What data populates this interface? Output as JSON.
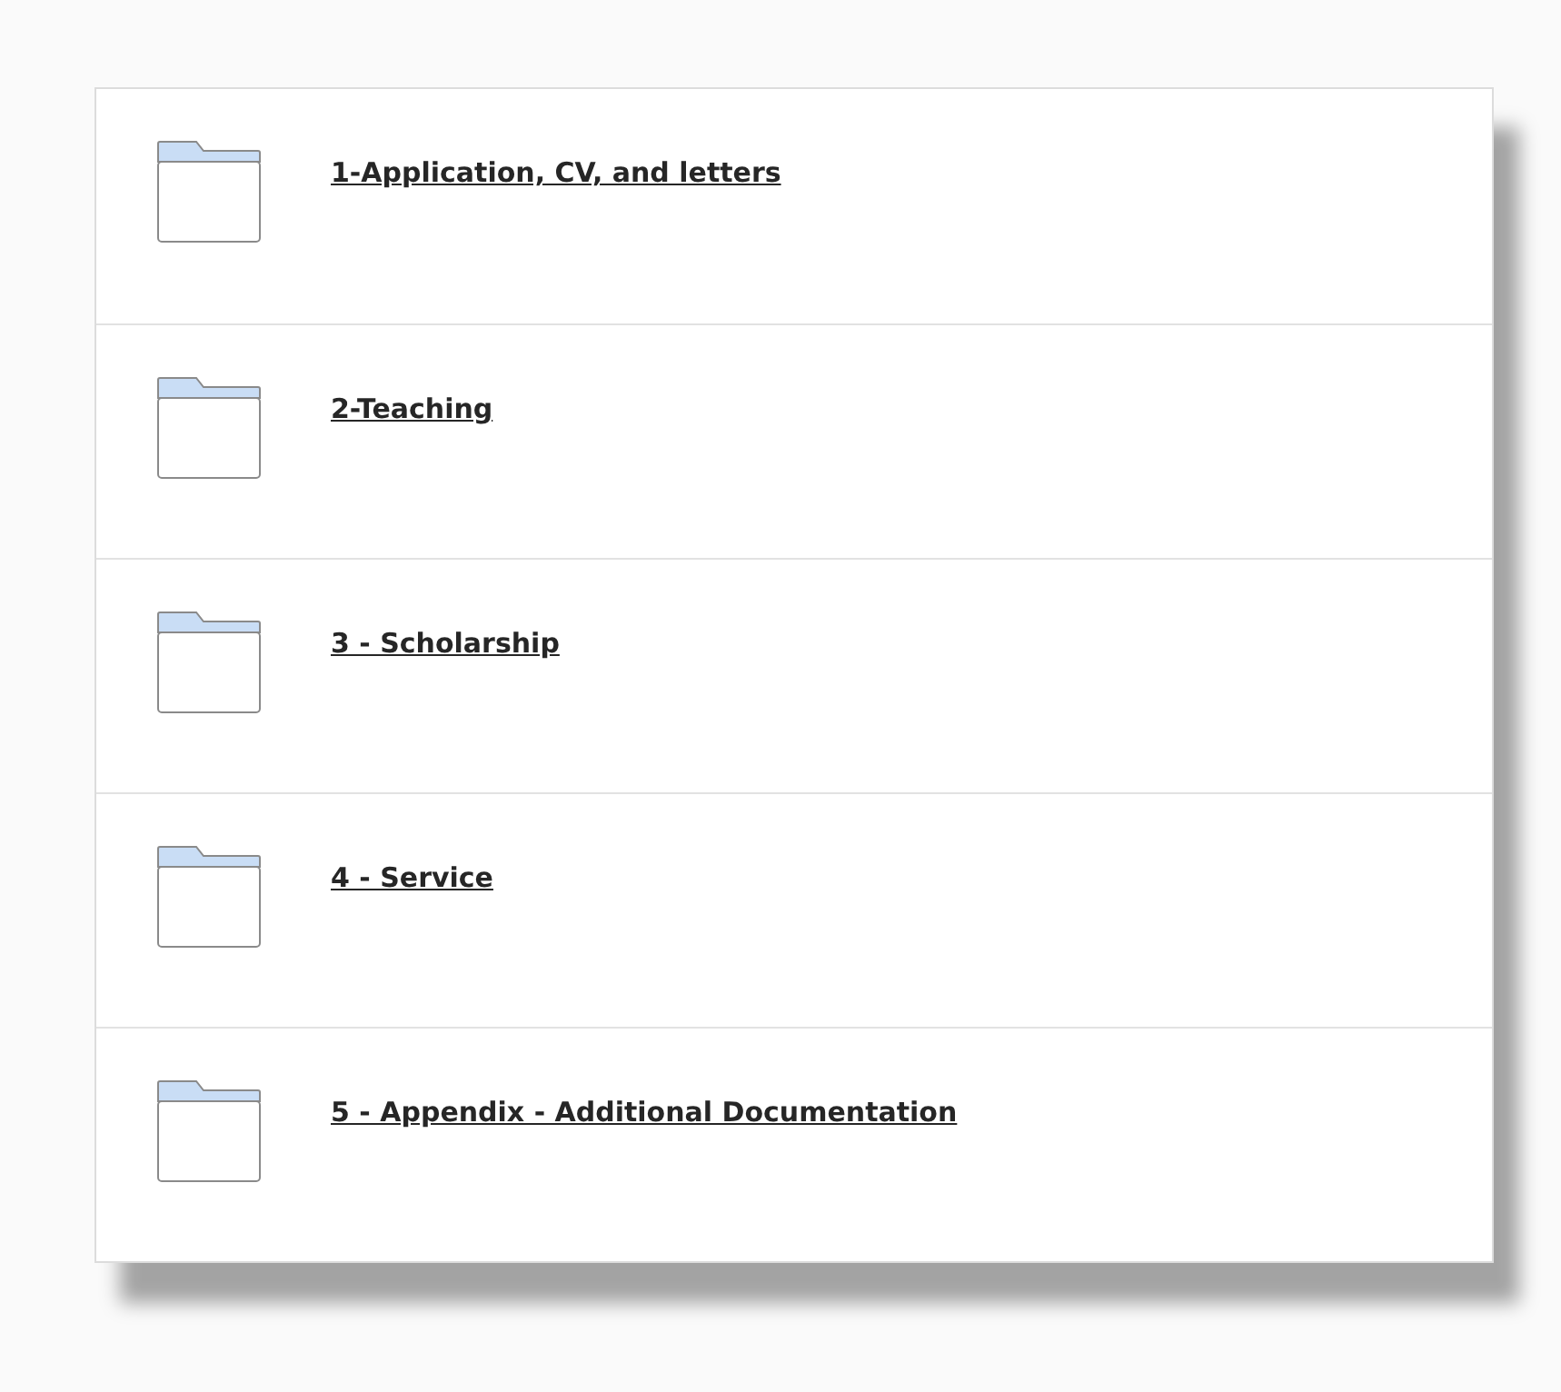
{
  "folders": [
    {
      "name": "1-Application, CV, and letters"
    },
    {
      "name": "2-Teaching"
    },
    {
      "name": "3 - Scholarship"
    },
    {
      "name": "4 - Service"
    },
    {
      "name": "5 - Appendix - Additional Documentation"
    }
  ]
}
